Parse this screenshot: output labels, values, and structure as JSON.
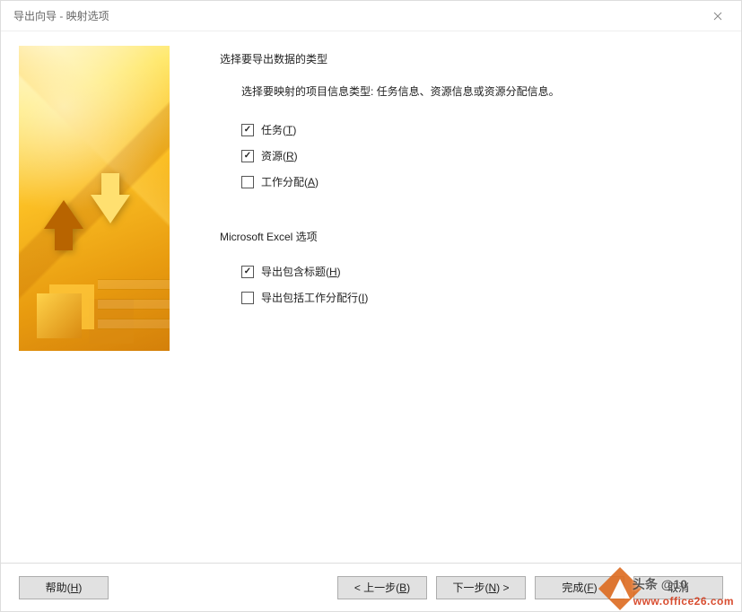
{
  "window": {
    "title": "导出向导 - 映射选项"
  },
  "section1": {
    "title": "选择要导出数据的类型",
    "description": "选择要映射的项目信息类型: 任务信息、资源信息或资源分配信息。"
  },
  "checkboxes": {
    "tasks": {
      "label_pre": "任务(",
      "hotkey": "T",
      "label_post": ")",
      "checked": true
    },
    "resources": {
      "label_pre": "资源(",
      "hotkey": "R",
      "label_post": ")",
      "checked": true
    },
    "assignments": {
      "label_pre": "工作分配(",
      "hotkey": "A",
      "label_post": ")",
      "checked": false
    }
  },
  "section2": {
    "title": "Microsoft Excel 选项"
  },
  "excel_options": {
    "include_headers": {
      "label_pre": "导出包含标题(",
      "hotkey": "H",
      "label_post": ")",
      "checked": true
    },
    "include_assignment_rows": {
      "label_pre": "导出包括工作分配行(",
      "hotkey": "I",
      "label_post": ")",
      "checked": false
    }
  },
  "buttons": {
    "help_pre": "帮助(",
    "help_hotkey": "H",
    "help_post": ")",
    "back_pre": "< 上一步(",
    "back_hotkey": "B",
    "back_post": ")",
    "next_pre": "下一步(",
    "next_hotkey": "N",
    "next_post": ") >",
    "finish_pre": "完成(",
    "finish_hotkey": "F",
    "finish_post": ")",
    "cancel": "取消"
  },
  "watermark": {
    "overlay": "头条 @10",
    "site": "www.office26.com"
  }
}
